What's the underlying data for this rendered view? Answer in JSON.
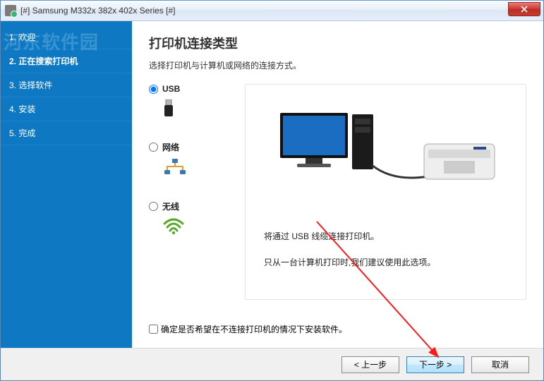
{
  "window": {
    "title": "[#] Samsung M332x 382x 402x Series [#]"
  },
  "sidebar": {
    "steps": [
      {
        "label": "1. 欢迎"
      },
      {
        "label": "2. 正在搜索打印机"
      },
      {
        "label": "3. 选择软件"
      },
      {
        "label": "4. 安装"
      },
      {
        "label": "5. 完成"
      }
    ],
    "watermark": "河东软件园"
  },
  "main": {
    "heading": "打印机连接类型",
    "subtitle": "选择打印机与计算机或网络的连接方式。",
    "options": {
      "usb": "USB",
      "network": "网络",
      "wireless": "无线"
    },
    "desc1": "将通过 USB 线缆连接打印机。",
    "desc2": "只从一台计算机打印时,我们建议使用此选项。",
    "checkbox_label": "确定是否希望在不连接打印机的情况下安装软件。"
  },
  "footer": {
    "back": "< 上一步",
    "next": "下一步 >",
    "cancel": "取消"
  }
}
